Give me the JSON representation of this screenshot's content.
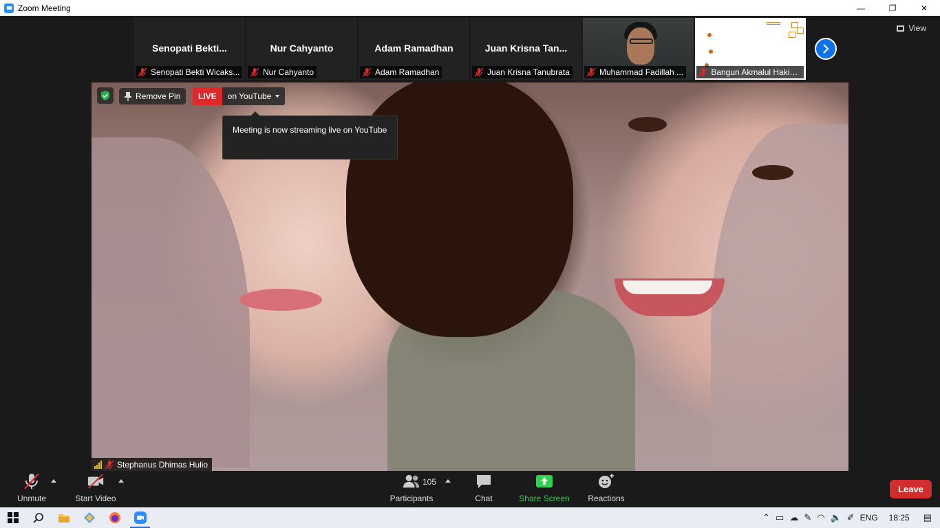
{
  "window": {
    "title": "Zoom Meeting",
    "minimize": "—",
    "restore": "❐",
    "close": "✕"
  },
  "view_button": {
    "label": "View"
  },
  "thumbnails": [
    {
      "display_name": "Senopati  Bekti...",
      "tag": "Senopati Bekti Wicaks...",
      "kind": "name"
    },
    {
      "display_name": "Nur Cahyanto",
      "tag": "Nur Cahyanto",
      "kind": "name"
    },
    {
      "display_name": "Adam Ramadhan",
      "tag": "Adam Ramadhan",
      "kind": "name"
    },
    {
      "display_name": "Juan  Krisna  Tan...",
      "tag": "Juan Krisna Tanubrata",
      "kind": "name"
    },
    {
      "display_name": "",
      "tag": "Muhammad Fadillah ...",
      "kind": "video"
    },
    {
      "display_name": "",
      "tag": "Bangun Akmalul Hakim ...",
      "kind": "screen"
    }
  ],
  "overlay": {
    "remove_pin": "Remove Pin",
    "live": "LIVE",
    "on_youtube": "on YouTube",
    "tooltip": "Meeting is now streaming live on YouTube"
  },
  "active_speaker": {
    "name": "Stephanus Dhimas Hulio"
  },
  "toolbar": {
    "unmute": "Unmute",
    "start_video": "Start Video",
    "participants": "Participants",
    "participant_count": "105",
    "chat": "Chat",
    "share_screen": "Share Screen",
    "reactions": "Reactions",
    "leave": "Leave"
  },
  "taskbar": {
    "language": "ENG",
    "time": "18:25"
  },
  "colors": {
    "accent_blue": "#0e72ed",
    "live_red": "#e02828",
    "leave_red": "#d12d2d",
    "share_green": "#2fd14d",
    "muted_red": "#e02828"
  }
}
